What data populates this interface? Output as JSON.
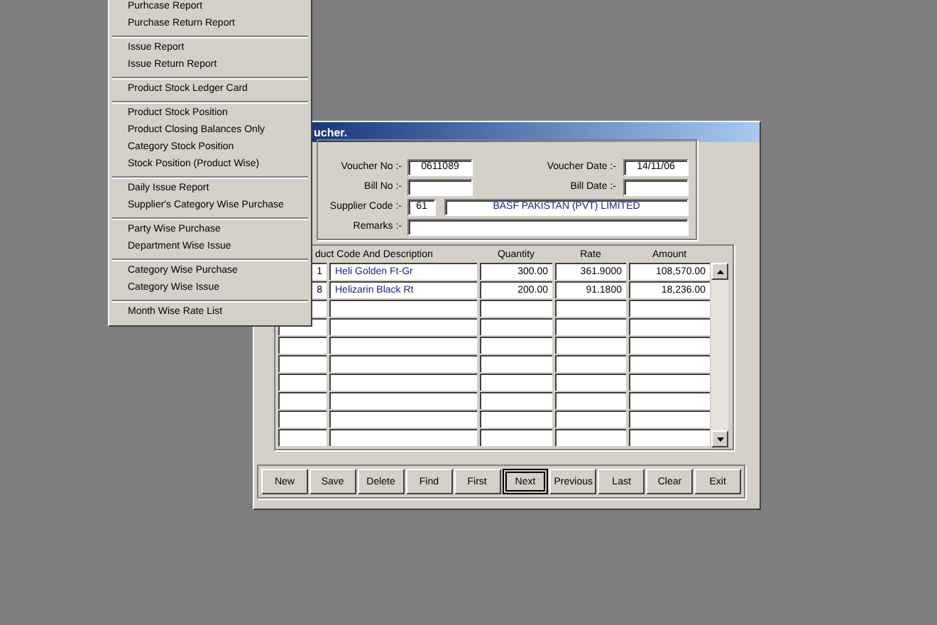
{
  "menu": {
    "groups": [
      [
        "Purhcase Report",
        "Purchase Return Report"
      ],
      [
        "Issue Report",
        "Issue Return Report"
      ],
      [
        "Product Stock Ledger Card"
      ],
      [
        "Product Stock Position",
        "Product Closing Balances Only",
        "Category Stock Position",
        "Stock Position (Product Wise)"
      ],
      [
        "Daily Issue Report",
        "Supplier's Category Wise Purchase"
      ],
      [
        "Party Wise Purchase",
        "Department Wise Issue"
      ],
      [
        "Category Wise Purchase",
        "Category Wise Issue"
      ],
      [
        "Month Wise Rate List"
      ]
    ]
  },
  "window": {
    "title": "ucher."
  },
  "form": {
    "voucher_no": {
      "label": "Voucher No :-",
      "value": "0611089"
    },
    "voucher_date": {
      "label": "Voucher Date :-",
      "value": "14/11/06"
    },
    "bill_no": {
      "label": "Bill No :-"
    },
    "bill_date": {
      "label": "Bill Date :-"
    },
    "supplier": {
      "label": "Supplier Code :-",
      "code": "61",
      "name": "BASF PAKISTAN (PVT) LIMITED"
    },
    "remarks": {
      "label": "Remarks :-"
    }
  },
  "table": {
    "columns": [
      "duct Code And Description",
      "Quantity",
      "Rate",
      "Amount"
    ],
    "rows": [
      {
        "code": "1",
        "description": "Heli Golden Ft-Gr",
        "quantity": "300.00",
        "rate": "361.9000",
        "amount": "108,570.00"
      },
      {
        "code": "8",
        "description": "Helizarin Black Rt",
        "quantity": "200.00",
        "rate": "91.1800",
        "amount": "18,236.00"
      }
    ]
  },
  "buttons": [
    {
      "label": "New",
      "focused": false
    },
    {
      "label": "Save",
      "focused": false
    },
    {
      "label": "Delete",
      "focused": false
    },
    {
      "label": "Find",
      "focused": false
    },
    {
      "label": "First",
      "focused": false
    },
    {
      "label": "Next",
      "focused": true
    },
    {
      "label": "Previous",
      "focused": false
    },
    {
      "label": "Last",
      "focused": false
    },
    {
      "label": "Clear",
      "focused": false
    },
    {
      "label": "Exit",
      "focused": false
    }
  ]
}
